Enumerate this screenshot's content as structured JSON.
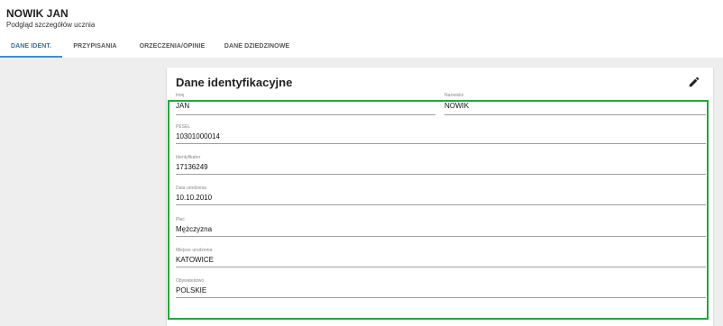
{
  "header": {
    "title": "NOWIK JAN",
    "subtitle": "Podgląd szczegółów ucznia"
  },
  "tabs": [
    {
      "label": "DANE IDENT.",
      "active": true
    },
    {
      "label": "PRZYPISANIA",
      "active": false
    },
    {
      "label": "ORZECZENIA/OPINIE",
      "active": false
    },
    {
      "label": "DANE DZIEDZINOWE",
      "active": false
    }
  ],
  "card": {
    "title": "Dane identyfikacyjne",
    "edit_icon": "pencil-icon",
    "fields": {
      "imie": {
        "label": "Imię",
        "value": "JAN"
      },
      "nazwisko": {
        "label": "Nazwisko",
        "value": "NOWIK"
      },
      "pesel": {
        "label": "PESEL",
        "value": "10301000014"
      },
      "identyfikator": {
        "label": "Identyfikator",
        "value": "17136249"
      },
      "data_urodzenia": {
        "label": "Data urodzenia",
        "value": "10.10.2010"
      },
      "plec": {
        "label": "Płeć",
        "value": "Mężczyzna"
      },
      "miejsce_urodzenia": {
        "label": "Miejsce urodzenia",
        "value": "KATOWICE"
      },
      "obywatelstwo": {
        "label": "Obywatelstwo",
        "value": "POLSKIE"
      }
    }
  },
  "colors": {
    "active_tab": "#3f8fd6",
    "highlight_border": "#22a83e"
  }
}
